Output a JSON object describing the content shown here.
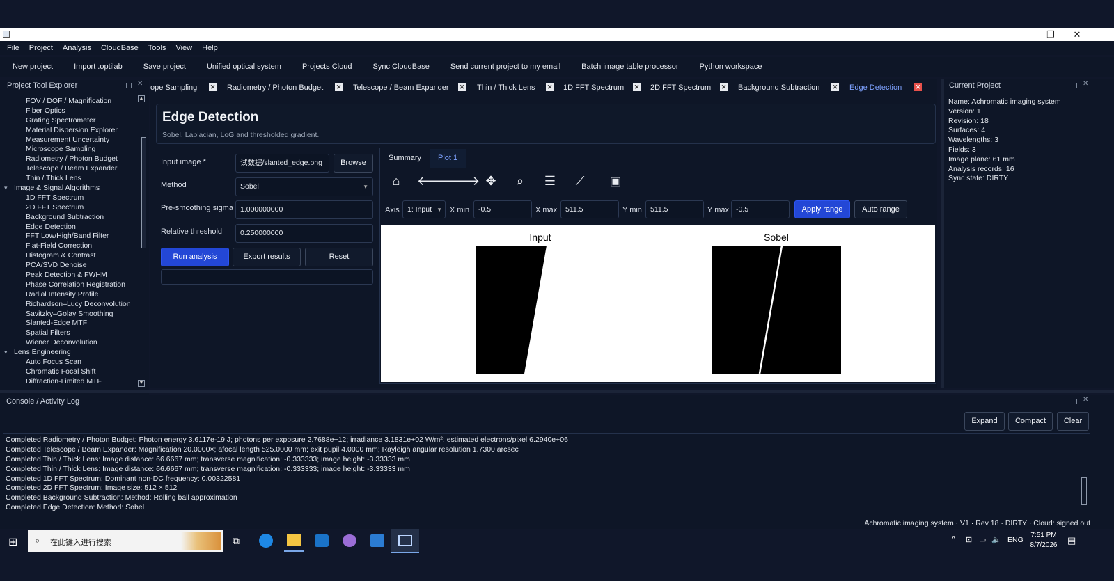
{
  "menu": [
    "File",
    "Project",
    "Analysis",
    "CloudBase",
    "Tools",
    "View",
    "Help"
  ],
  "toolbar": [
    "New project",
    "Import .optilab",
    "Save project",
    "Unified optical system",
    "Projects  Cloud",
    "Sync CloudBase",
    "Send current project to my email",
    "Batch image  table processor",
    "Python workspace"
  ],
  "left_panel": {
    "title": "Project  Tool Explorer",
    "tree": [
      {
        "t": "leaf",
        "label": "FOV / DOF / Magnification"
      },
      {
        "t": "leaf",
        "label": "Fiber Optics"
      },
      {
        "t": "leaf",
        "label": "Grating Spectrometer"
      },
      {
        "t": "leaf",
        "label": "Material Dispersion Explorer"
      },
      {
        "t": "leaf",
        "label": "Measurement Uncertainty"
      },
      {
        "t": "leaf",
        "label": "Microscope Sampling"
      },
      {
        "t": "leaf",
        "label": "Radiometry / Photon Budget"
      },
      {
        "t": "leaf",
        "label": "Telescope / Beam Expander"
      },
      {
        "t": "leaf",
        "label": "Thin / Thick Lens"
      },
      {
        "t": "cat",
        "label": "Image & Signal Algorithms"
      },
      {
        "t": "leaf",
        "label": "1D FFT Spectrum"
      },
      {
        "t": "leaf",
        "label": "2D FFT Spectrum"
      },
      {
        "t": "leaf",
        "label": "Background Subtraction"
      },
      {
        "t": "leaf",
        "label": "Edge Detection"
      },
      {
        "t": "leaf",
        "label": "FFT Low/High/Band Filter"
      },
      {
        "t": "leaf",
        "label": "Flat-Field Correction"
      },
      {
        "t": "leaf",
        "label": "Histogram & Contrast"
      },
      {
        "t": "leaf",
        "label": "PCA/SVD Denoise"
      },
      {
        "t": "leaf",
        "label": "Peak Detection & FWHM"
      },
      {
        "t": "leaf",
        "label": "Phase Correlation Registration"
      },
      {
        "t": "leaf",
        "label": "Radial Intensity Profile"
      },
      {
        "t": "leaf",
        "label": "Richardson–Lucy Deconvolution"
      },
      {
        "t": "leaf",
        "label": "Savitzky–Golay Smoothing"
      },
      {
        "t": "leaf",
        "label": "Slanted-Edge MTF"
      },
      {
        "t": "leaf",
        "label": "Spatial Filters"
      },
      {
        "t": "leaf",
        "label": "Wiener Deconvolution"
      },
      {
        "t": "cat",
        "label": "Lens Engineering"
      },
      {
        "t": "leaf",
        "label": "Auto Focus Scan"
      },
      {
        "t": "leaf",
        "label": "Chromatic Focal Shift"
      },
      {
        "t": "leaf",
        "label": "Diffraction-Limited MTF"
      }
    ]
  },
  "tabs": [
    {
      "label": "ope Sampling"
    },
    {
      "label": "Radiometry / Photon Budget"
    },
    {
      "label": "Telescope / Beam Expander"
    },
    {
      "label": "Thin / Thick Lens"
    },
    {
      "label": "1D FFT Spectrum"
    },
    {
      "label": "2D FFT Spectrum"
    },
    {
      "label": "Background Subtraction"
    },
    {
      "label": "Edge Detection",
      "active": true
    }
  ],
  "page": {
    "title": "Edge Detection",
    "subtitle": "Sobel, Laplacian, LoG and thresholded gradient."
  },
  "form": {
    "input_image_label": "Input image *",
    "input_image_value": "试数据/slanted_edge.png",
    "browse": "Browse",
    "method_label": "Method",
    "method_value": "Sobel",
    "sigma_label": "Pre-smoothing sigma",
    "sigma_value": "1.000000000",
    "threshold_label": "Relative threshold",
    "threshold_value": "0.250000000",
    "run": "Run analysis",
    "export": "Export results",
    "reset": "Reset"
  },
  "plot_tabs": [
    "Summary",
    "Plot 1"
  ],
  "plot_icons": [
    "home-icon",
    "back-arrow-icon",
    "forward-arrow-icon",
    "pan-icon",
    "zoom-icon",
    "configure-icon",
    "edit-curve-icon",
    "save-icon"
  ],
  "range": {
    "axis_label": "Axis",
    "axis_value": "1: Input",
    "xmin_label": "X min",
    "xmin": "-0.5",
    "xmax_label": "X max",
    "xmax": "511.5",
    "ymin_label": "Y min",
    "ymin": "511.5",
    "ymax_label": "Y max",
    "ymax": "-0.5",
    "apply": "Apply range",
    "auto": "Auto range"
  },
  "subplots": [
    {
      "title": "Input"
    },
    {
      "title": "Sobel"
    }
  ],
  "right_panel": {
    "title": "Current Project",
    "lines": [
      "Name: Achromatic imaging system",
      "Version: 1",
      "Revision: 18",
      "Surfaces: 4",
      "Wavelengths: 3",
      "Fields: 3",
      "Image plane: 61 mm",
      "Analysis records: 16",
      "Sync state: DIRTY"
    ]
  },
  "console": {
    "title": "Console / Activity Log",
    "buttons": [
      "Expand",
      "Compact",
      "Clear"
    ],
    "lines": [
      "Completed Radiometry / Photon Budget: Photon energy 3.6117e-19 J; photons per exposure 2.7688e+12; irradiance 3.1831e+02 W/m²; estimated electrons/pixel 6.2940e+06",
      "Completed Telescope / Beam Expander: Magnification 20.0000×; afocal length 525.0000 mm; exit pupil 4.0000 mm; Rayleigh angular resolution 1.7300 arcsec",
      "Completed Thin / Thick Lens: Image distance: 66.6667 mm; transverse magnification: -0.333333; image height: -3.33333 mm",
      "Completed Thin / Thick Lens: Image distance: 66.6667 mm; transverse magnification: -0.333333; image height: -3.33333 mm",
      "Completed 1D FFT Spectrum: Dominant non-DC frequency: 0.00322581",
      "Completed 2D FFT Spectrum: Image size: 512 × 512",
      "Completed Background Subtraction: Method: Rolling ball approximation",
      "Completed Edge Detection: Method: Sobel"
    ]
  },
  "status": "Achromatic imaging system · V1 · Rev 18 · DIRTY · Cloud: signed out",
  "taskbar": {
    "search_placeholder": "在此键入进行搜索",
    "lang": "ENG",
    "time": "7:51 PM",
    "date": "8/7/2026"
  }
}
